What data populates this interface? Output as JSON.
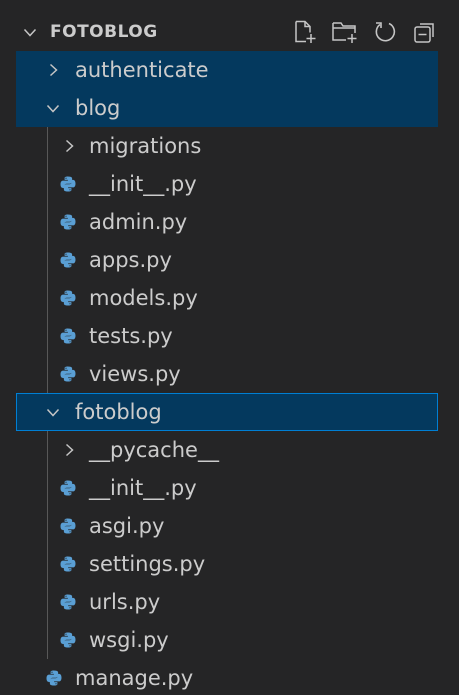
{
  "explorer": {
    "title": "FOTOBLOG",
    "actions": [
      {
        "name": "new-file-icon"
      },
      {
        "name": "new-folder-icon"
      },
      {
        "name": "refresh-icon"
      },
      {
        "name": "collapse-all-icon"
      }
    ]
  },
  "tree": {
    "authenticate": "authenticate",
    "blog": "blog",
    "blog_migrations": "migrations",
    "blog_init": "__init__.py",
    "blog_admin": "admin.py",
    "blog_apps": "apps.py",
    "blog_models": "models.py",
    "blog_tests": "tests.py",
    "blog_views": "views.py",
    "fotoblog": "fotoblog",
    "fotoblog_pycache": "__pycache__",
    "fotoblog_init": "__init__.py",
    "fotoblog_asgi": "asgi.py",
    "fotoblog_settings": "settings.py",
    "fotoblog_urls": "urls.py",
    "fotoblog_wsgi": "wsgi.py",
    "manage": "manage.py"
  },
  "colors": {
    "background": "#252526",
    "selected": "#04395e",
    "focus_border": "#007fd4",
    "python_blue": "#4b9cd3",
    "python_yellow": "#ffd43b"
  }
}
